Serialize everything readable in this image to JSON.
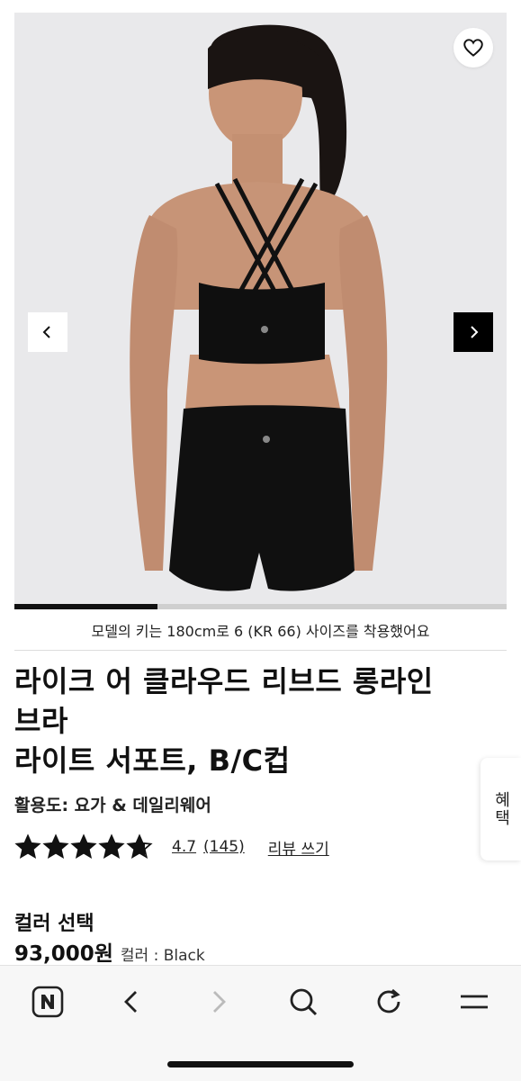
{
  "gallery": {
    "image_description_icon": "product-photo",
    "progress_fraction": 0.29
  },
  "caption": "모델의 키는 180cm로 6 (KR 66) 사이즈를 착용했어요",
  "product": {
    "title_lines": [
      "라이크 어 클라우드 리브드 롱라인",
      "브라",
      "라이트 서포트, B/C컵"
    ],
    "usage": "활용도: 요가 & 데일리웨어",
    "rating": {
      "stars": 4.7,
      "value": "4.7",
      "count": "(145)"
    },
    "write_review": "리뷰 쓰기"
  },
  "side_tab": "혜택",
  "color": {
    "heading": "컬러 선택",
    "price": "93,000원",
    "label": "컬러 : Black"
  },
  "browser_bar": {
    "icons": [
      "naver-icon",
      "back-icon",
      "forward-icon",
      "search-icon",
      "refresh-icon",
      "menu-icon"
    ]
  }
}
